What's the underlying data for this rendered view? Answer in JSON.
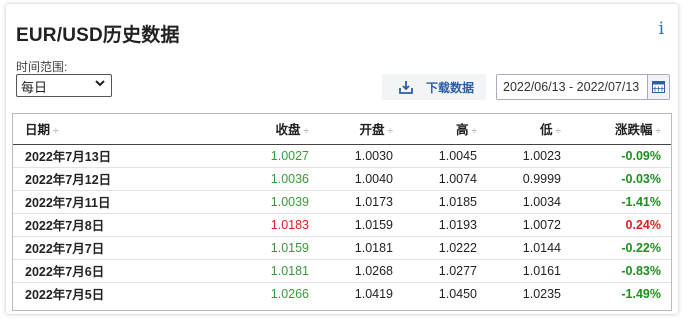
{
  "title": "EUR/USD历史数据",
  "controls": {
    "range_label": "时间范围:",
    "range_value": "每日",
    "download_label": "下载数据",
    "date_range": "2022/06/13 - 2022/07/13"
  },
  "table": {
    "headers": {
      "date": "日期",
      "close": "收盘",
      "open": "开盘",
      "high": "高",
      "low": "低",
      "change": "涨跌幅"
    },
    "sort_symbol": "÷",
    "rows": [
      {
        "date": "2022年7月13日",
        "close": "1.0027",
        "open": "1.0030",
        "high": "1.0045",
        "low": "1.0023",
        "change": "-0.09%",
        "dir": "down"
      },
      {
        "date": "2022年7月12日",
        "close": "1.0036",
        "open": "1.0040",
        "high": "1.0074",
        "low": "0.9999",
        "change": "-0.03%",
        "dir": "down"
      },
      {
        "date": "2022年7月11日",
        "close": "1.0039",
        "open": "1.0173",
        "high": "1.0185",
        "low": "1.0034",
        "change": "-1.41%",
        "dir": "down"
      },
      {
        "date": "2022年7月8日",
        "close": "1.0183",
        "open": "1.0159",
        "high": "1.0193",
        "low": "1.0072",
        "change": "0.24%",
        "dir": "up"
      },
      {
        "date": "2022年7月7日",
        "close": "1.0159",
        "open": "1.0181",
        "high": "1.0222",
        "low": "1.0144",
        "change": "-0.22%",
        "dir": "down"
      },
      {
        "date": "2022年7月6日",
        "close": "1.0181",
        "open": "1.0268",
        "high": "1.0277",
        "low": "1.0161",
        "change": "-0.83%",
        "dir": "down"
      },
      {
        "date": "2022年7月5日",
        "close": "1.0266",
        "open": "1.0419",
        "high": "1.0450",
        "low": "1.0235",
        "change": "-1.49%",
        "dir": "down"
      }
    ]
  },
  "colors": {
    "down_close": "#3a9a3a",
    "down_change": "#1f8f1f",
    "up": "#e02020",
    "link": "#2a5fa8"
  },
  "icons": {
    "info": "info-icon",
    "download": "download-icon",
    "calendar": "calendar-icon",
    "dropdown": "chevron-down-icon"
  }
}
